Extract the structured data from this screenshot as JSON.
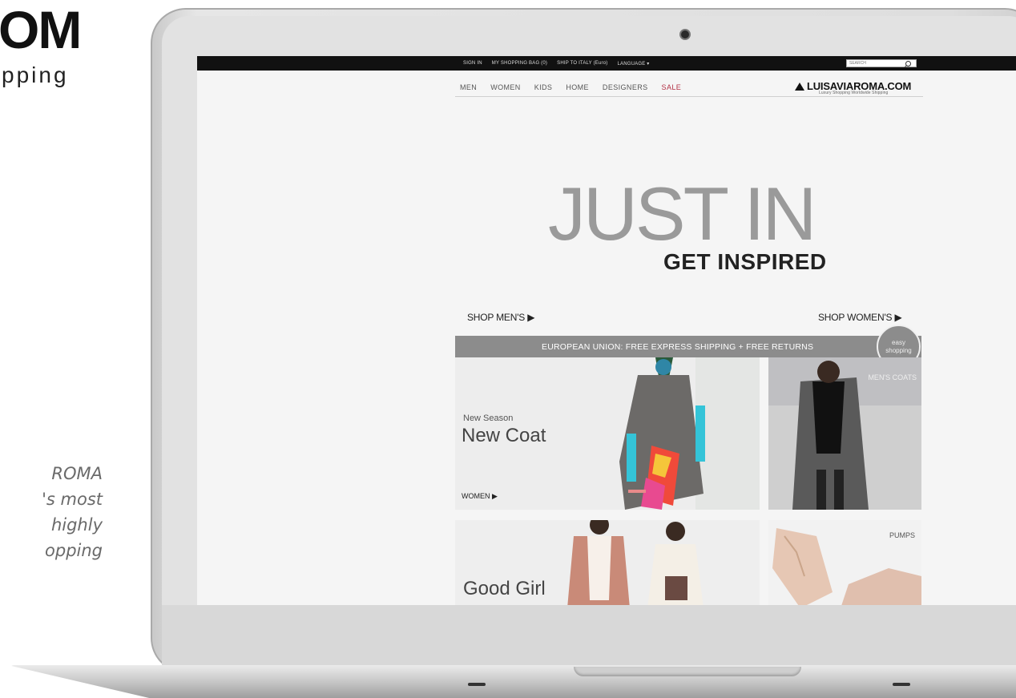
{
  "brand": {
    "logo_fragment": "OM",
    "tagline_fragment": "pping",
    "description_lines": [
      "ROMA",
      "'s most",
      "highly",
      "opping"
    ]
  },
  "website": {
    "topbar": {
      "sign_in": "SIGN IN",
      "shopping_bag": "MY SHOPPING BAG (0)",
      "ship_to": "SHIP TO ITALY (Euro)",
      "language": "LANGUAGE ▾",
      "search_placeholder": "SEARCH"
    },
    "nav": [
      "MEN",
      "WOMEN",
      "KIDS",
      "HOME",
      "DESIGNERS",
      "SALE"
    ],
    "logo": "LUISAVIAROMA.COM",
    "logo_subtitle": "Luxury Shopping Worldwide Shipping",
    "hero": {
      "title": "JUST IN",
      "subtitle": "GET INSPIRED"
    },
    "shop_men": "SHOP MEN'S ▶",
    "shop_women": "SHOP WOMEN'S ▶",
    "promo": "EUROPEAN UNION: FREE EXPRESS SHIPPING + FREE RETURNS",
    "badge": [
      "easy",
      "shopping"
    ],
    "tiles": {
      "coat": {
        "kicker": "New Season",
        "title": "New Coat",
        "link": "WOMEN ▶"
      },
      "mens_coats": "MEN'S COATS",
      "good_girl": "Good Girl",
      "pumps": "PUMPS"
    }
  }
}
